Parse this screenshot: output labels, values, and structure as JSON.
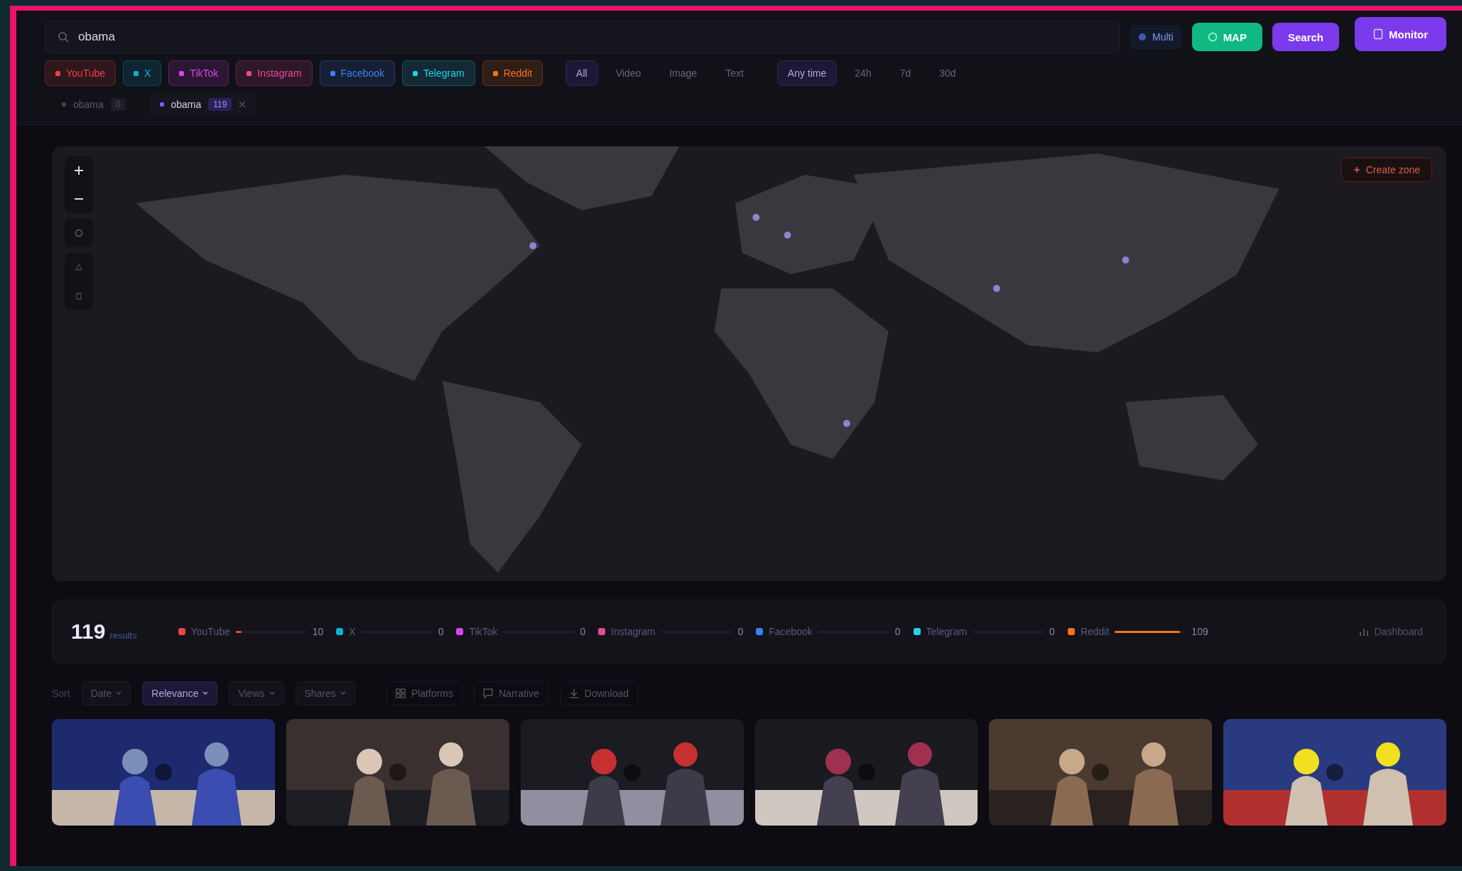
{
  "search": {
    "value": "obama"
  },
  "actions": [
    {
      "label": "Multi",
      "kind": "link"
    },
    {
      "label": "MAP",
      "kind": "green"
    },
    {
      "label": "Search",
      "kind": "purple"
    },
    {
      "label": "Monitor",
      "kind": "monitor"
    }
  ],
  "platform_filters": [
    {
      "label": "YouTube",
      "color": "#ef4444",
      "selected": true
    },
    {
      "label": "X",
      "color": "#06b6d4",
      "selected": true
    },
    {
      "label": "TikTok",
      "color": "#d946ef",
      "selected": true
    },
    {
      "label": "Instagram",
      "color": "#ec4899",
      "selected": true
    },
    {
      "label": "Facebook",
      "color": "#3b82f6",
      "selected": true
    },
    {
      "label": "Telegram",
      "color": "#22d3ee",
      "selected": true
    },
    {
      "label": "Reddit",
      "color": "#f97316",
      "selected": true
    }
  ],
  "type_filters": [
    {
      "label": "All",
      "selected": true
    },
    {
      "label": "Video",
      "selected": false
    },
    {
      "label": "Image",
      "selected": false
    },
    {
      "label": "Text",
      "selected": false
    }
  ],
  "time_filters": [
    {
      "label": "Any time",
      "selected": true
    },
    {
      "label": "24h",
      "selected": false
    },
    {
      "label": "7d",
      "selected": false
    },
    {
      "label": "30d",
      "selected": false
    }
  ],
  "queries": [
    {
      "label": "obama",
      "count": "0",
      "selected": false
    },
    {
      "label": "obama",
      "count": "119",
      "selected": true
    }
  ],
  "map": {
    "create_zone": "Create zone"
  },
  "stats": {
    "total": "119",
    "total_label": "results",
    "platforms": [
      {
        "name": "YouTube",
        "color": "#ef4444",
        "level": 0.08,
        "count": "10"
      },
      {
        "name": "X",
        "color": "#06b6d4",
        "level": 0,
        "count": "0"
      },
      {
        "name": "TikTok",
        "color": "#d946ef",
        "level": 0,
        "count": "0"
      },
      {
        "name": "Instagram",
        "color": "#ec4899",
        "level": 0,
        "count": "0"
      },
      {
        "name": "Facebook",
        "color": "#3b82f6",
        "level": 0,
        "count": "0"
      },
      {
        "name": "Telegram",
        "color": "#22d3ee",
        "level": 0,
        "count": "0"
      },
      {
        "name": "Reddit",
        "color": "#f97316",
        "level": 0.92,
        "count": "109"
      }
    ],
    "dashboard": "Dashboard"
  },
  "sort": {
    "label": "Sort",
    "options": [
      {
        "label": "Date",
        "selected": false
      },
      {
        "label": "Relevance",
        "selected": true
      },
      {
        "label": "Views",
        "selected": false
      },
      {
        "label": "Shares",
        "selected": false
      }
    ],
    "tools": [
      {
        "label": "Platforms",
        "kind": "grid"
      },
      {
        "label": "Narrative",
        "kind": "chat"
      },
      {
        "label": "Download",
        "kind": "download"
      }
    ]
  }
}
